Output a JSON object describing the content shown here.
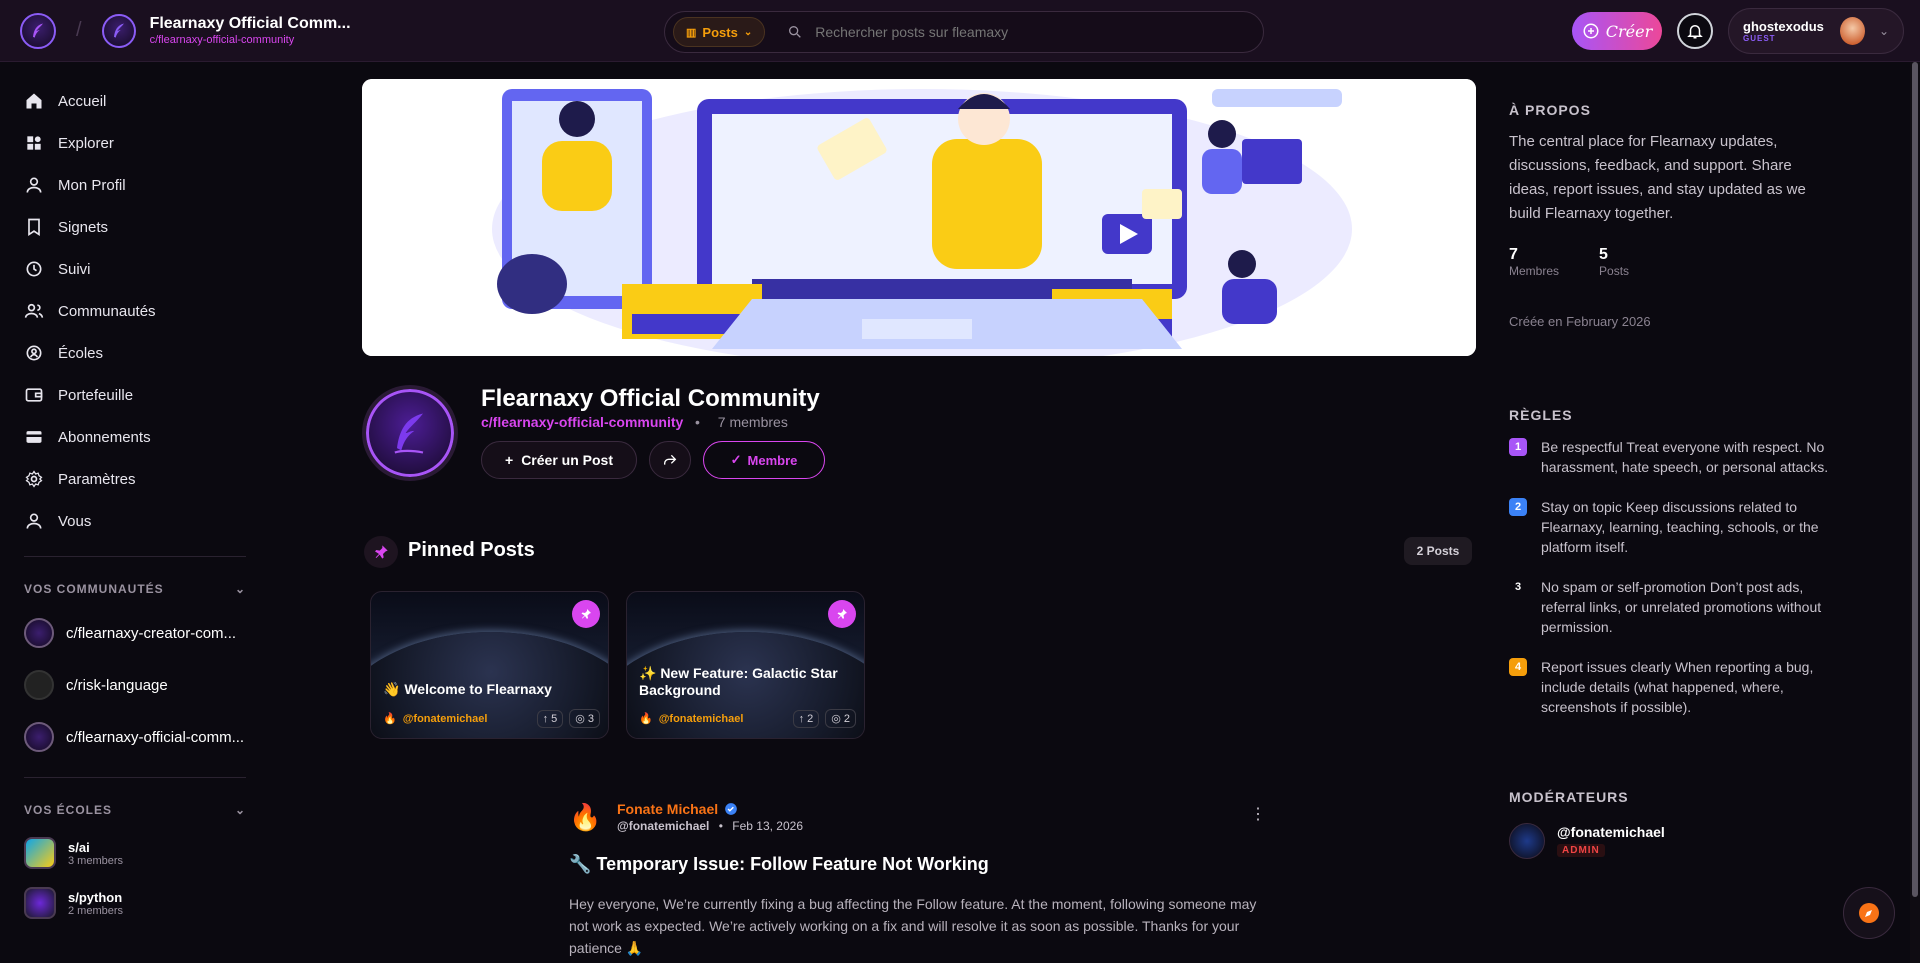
{
  "header": {
    "community_title": "Flearnaxy Official Comm...",
    "community_slug": "c/flearnaxy-official-community",
    "posts_filter": "Posts",
    "search_placeholder": "Rechercher posts sur fleamaxy",
    "create_label": "Créer",
    "user_name": "ghostexodus",
    "user_role": "GUEST"
  },
  "sidebar": {
    "nav": [
      {
        "label": "Accueil",
        "icon": "home-icon"
      },
      {
        "label": "Explorer",
        "icon": "grid-icon"
      },
      {
        "label": "Mon Profil",
        "icon": "user-icon"
      },
      {
        "label": "Signets",
        "icon": "bookmark-icon"
      },
      {
        "label": "Suivi",
        "icon": "history-icon"
      },
      {
        "label": "Communautés",
        "icon": "users-icon"
      },
      {
        "label": "Écoles",
        "icon": "school-icon"
      },
      {
        "label": "Portefeuille",
        "icon": "wallet-icon"
      },
      {
        "label": "Abonnements",
        "icon": "card-icon"
      },
      {
        "label": "Paramètres",
        "icon": "gear-icon"
      },
      {
        "label": "Vous",
        "icon": "person-icon"
      }
    ],
    "communities_header": "VOS COMMUNAUTÉS",
    "communities": [
      {
        "label": "c/flearnaxy-creator-com..."
      },
      {
        "label": "c/risk-language"
      },
      {
        "label": "c/flearnaxy-official-comm..."
      }
    ],
    "schools_header": "VOS ÉCOLES",
    "schools": [
      {
        "name": "s/ai",
        "count": "3 members"
      },
      {
        "name": "s/python",
        "count": "2 members"
      }
    ]
  },
  "community": {
    "title": "Flearnaxy Official Community",
    "slug": "c/flearnaxy-official-community",
    "members": "7 membres",
    "separator": "•",
    "create_post_label": "Créer un Post",
    "member_label": "Membre"
  },
  "pinned": {
    "title": "Pinned Posts",
    "count_label": "2 Posts",
    "cards": [
      {
        "title": "👋 Welcome to Flearnaxy",
        "author": "@fonatemichael",
        "upvotes": "5",
        "views": "3"
      },
      {
        "title": "✨ New Feature: Galactic Star Background",
        "author": "@fonatemichael",
        "upvotes": "2",
        "views": "2"
      }
    ]
  },
  "post": {
    "author": "Fonate Michael",
    "handle": "@fonatemichael",
    "date": "Feb 13, 2026",
    "separator": "•",
    "title": "🔧 Temporary Issue: Follow Feature Not Working",
    "body": "Hey everyone, We’re currently fixing a bug affecting the Follow feature. At the moment, following someone may not work as expected. We’re actively working on a fix and will resolve it as soon as possible. Thanks for your patience 🙏"
  },
  "about": {
    "header": "À PROPOS",
    "description": "The central place for Flearnaxy updates, discussions, feedback, and support. Share ideas, report issues, and stay updated as we build Flearnaxy together.",
    "members_value": "7",
    "members_label": "Membres",
    "posts_value": "5",
    "posts_label": "Posts",
    "created": "Créée en February 2026"
  },
  "rules": {
    "header": "RÈGLES",
    "items": [
      {
        "num": "1",
        "color": "#a855f7",
        "text": "Be respectful Treat everyone with respect. No harassment, hate speech, or personal attacks."
      },
      {
        "num": "2",
        "color": "#3b82f6",
        "text": "Stay on topic Keep discussions related to Flearnaxy, learning, teaching, schools, or the platform itself."
      },
      {
        "num": "3",
        "color": "transparent",
        "text": "No spam or self-promotion Don’t post ads, referral links, or unrelated promotions without permission."
      },
      {
        "num": "4",
        "color": "#f59e0b",
        "text": "Report issues clearly When reporting a bug, include details (what happened, where, screenshots if possible)."
      }
    ]
  },
  "moderators": {
    "header": "MODÉRATEURS",
    "items": [
      {
        "name": "@fonatemichael",
        "role": "ADMIN"
      }
    ]
  }
}
